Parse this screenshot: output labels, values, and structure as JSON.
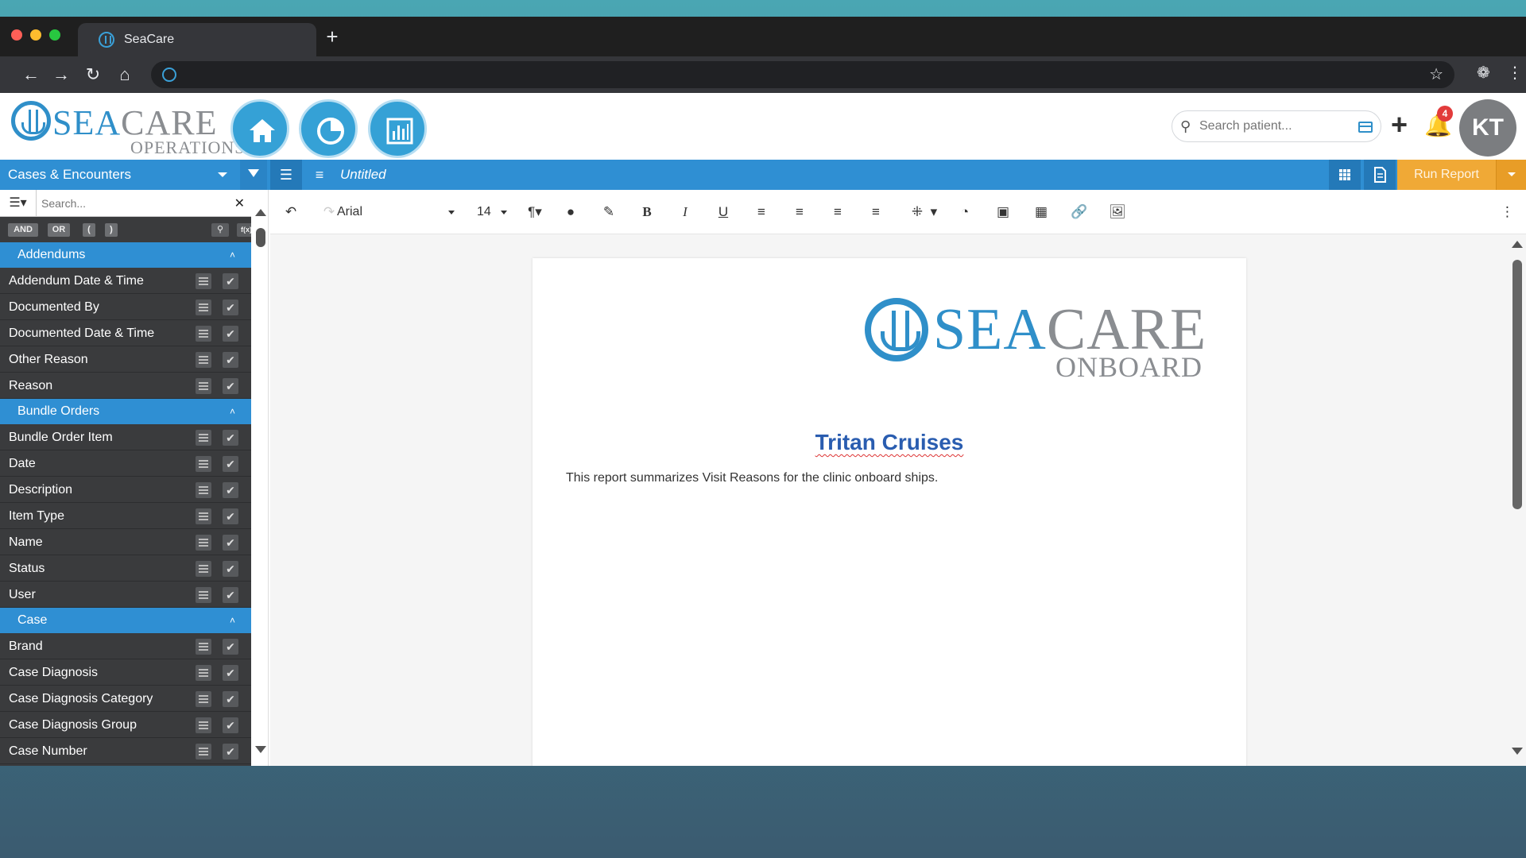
{
  "browser": {
    "tab_title": "SeaCare",
    "new_tab_glyph": "+"
  },
  "header": {
    "logo": {
      "brand_sea": "SEA",
      "brand_care": "CARE",
      "subtitle": "OPERATIONS"
    },
    "nav_buttons": [
      "home-icon",
      "pie-chart-icon",
      "bar-chart-icon"
    ],
    "search": {
      "placeholder": "Search patient..."
    },
    "add_glyph": "+",
    "notifications_count": "4",
    "avatar_initials": "KT",
    "brand_color": "#2f8fd3"
  },
  "toolbar": {
    "datasource": "Cases & Encounters",
    "doc_title": "Untitled",
    "run_report_label": "Run Report",
    "run_report_color": "#f0a936"
  },
  "sidebar": {
    "search_placeholder": "Search...",
    "ops": [
      "AND",
      "OR",
      "(",
      ")"
    ],
    "formula_label": "f(x)",
    "groups": [
      {
        "label": "Addendums",
        "fields": [
          "Addendum Date & Time",
          "Documented By",
          "Documented Date & Time",
          "Other Reason",
          "Reason"
        ]
      },
      {
        "label": "Bundle Orders",
        "fields": [
          "Bundle Order Item",
          "Date",
          "Description",
          "Item Type",
          "Name",
          "Status",
          "User"
        ]
      },
      {
        "label": "Case",
        "fields": [
          "Brand",
          "Case Diagnosis",
          "Case Diagnosis Category",
          "Case Diagnosis Group",
          "Case Number"
        ]
      }
    ]
  },
  "editor": {
    "font_family": "Arial",
    "font_size": "14",
    "document": {
      "logo": {
        "brand_sea": "SEA",
        "brand_care": "CARE",
        "subtitle": "ONBOARD"
      },
      "title": "Tritan Cruises",
      "body": "This report summarizes Visit Reasons for the clinic onboard ships."
    }
  }
}
